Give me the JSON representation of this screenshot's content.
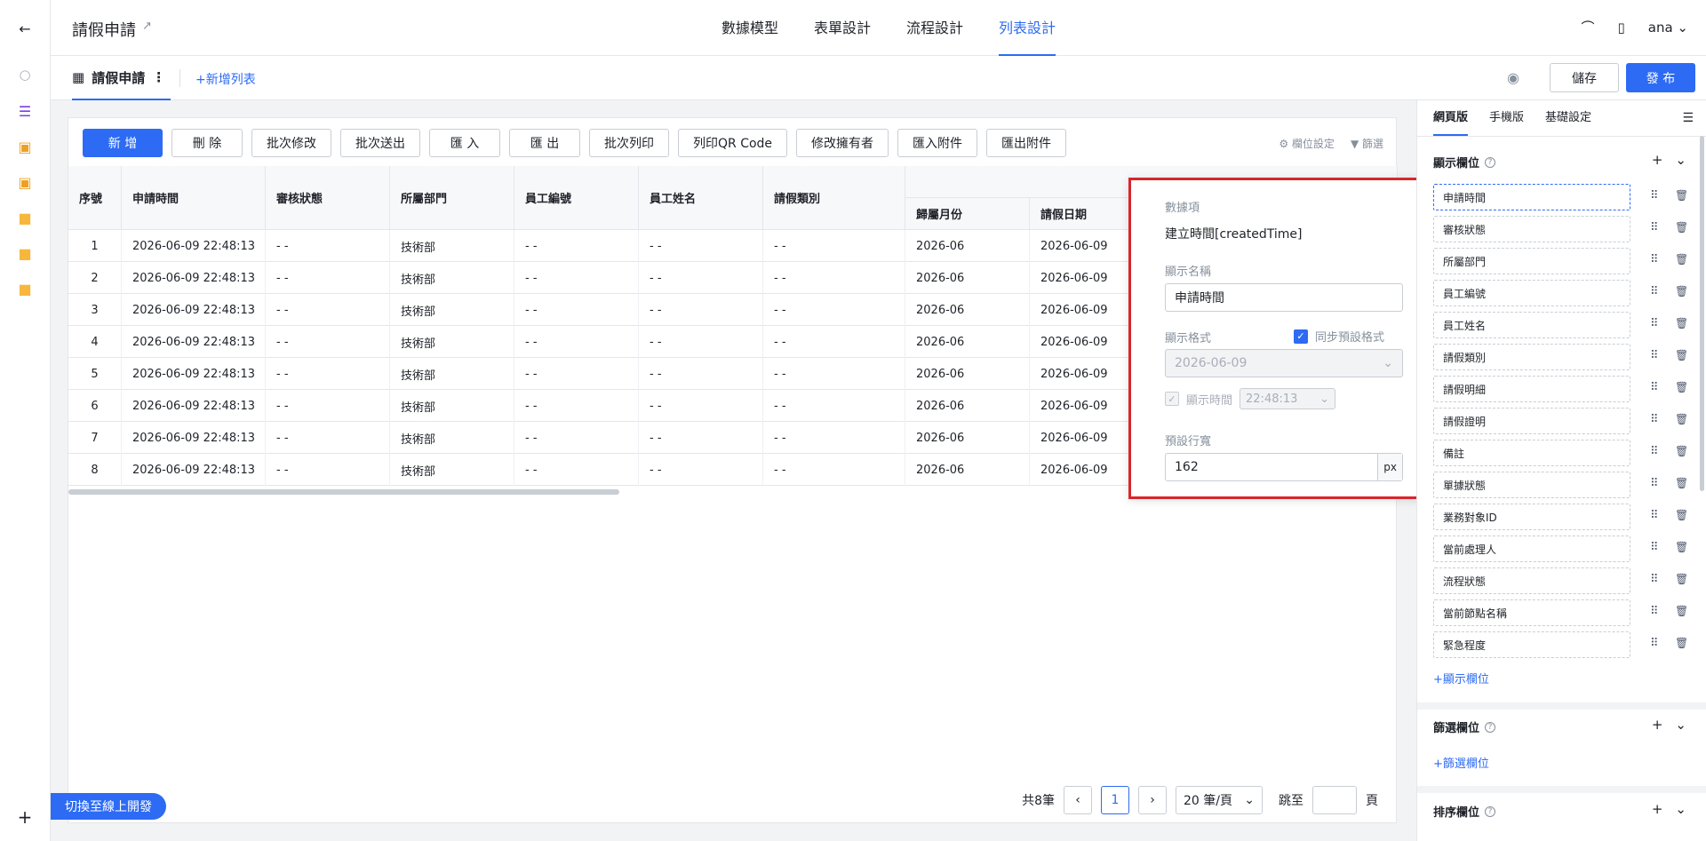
{
  "app": {
    "title": "請假申請",
    "user": "ana",
    "tabs": [
      {
        "label": "數據模型"
      },
      {
        "label": "表單設計"
      },
      {
        "label": "流程設計"
      },
      {
        "label": "列表設計",
        "active": true
      }
    ]
  },
  "subbar": {
    "list_name": "請假申請",
    "add_list": "新增列表",
    "save": "儲存",
    "publish": "發 布"
  },
  "toolbar": {
    "buttons": [
      "新 增",
      "刪 除",
      "批次修改",
      "批次送出",
      "匯 入",
      "匯 出",
      "批次列印",
      "列印QR Code",
      "修改擁有者",
      "匯入附件",
      "匯出附件"
    ],
    "field_settings": "欄位設定",
    "filter": "篩選"
  },
  "table": {
    "headers": [
      "序號",
      "申請時間",
      "審核狀態",
      "所屬部門",
      "員工編號",
      "員工姓名",
      "請假類別"
    ],
    "sub_headers": [
      "歸屬月份",
      "請假日期"
    ],
    "rows": [
      {
        "no": "1",
        "time": "2026-06-09 22:48:13",
        "status": "- -",
        "dept": "技術部",
        "emp_no": "- -",
        "emp_name": "- -",
        "type": "- -",
        "month": "2026-06",
        "date": "2026-06-09"
      },
      {
        "no": "2",
        "time": "2026-06-09 22:48:13",
        "status": "- -",
        "dept": "技術部",
        "emp_no": "- -",
        "emp_name": "- -",
        "type": "- -",
        "month": "2026-06",
        "date": "2026-06-09"
      },
      {
        "no": "3",
        "time": "2026-06-09 22:48:13",
        "status": "- -",
        "dept": "技術部",
        "emp_no": "- -",
        "emp_name": "- -",
        "type": "- -",
        "month": "2026-06",
        "date": "2026-06-09"
      },
      {
        "no": "4",
        "time": "2026-06-09 22:48:13",
        "status": "- -",
        "dept": "技術部",
        "emp_no": "- -",
        "emp_name": "- -",
        "type": "- -",
        "month": "2026-06",
        "date": "2026-06-09"
      },
      {
        "no": "5",
        "time": "2026-06-09 22:48:13",
        "status": "- -",
        "dept": "技術部",
        "emp_no": "- -",
        "emp_name": "- -",
        "type": "- -",
        "month": "2026-06",
        "date": "2026-06-09"
      },
      {
        "no": "6",
        "time": "2026-06-09 22:48:13",
        "status": "- -",
        "dept": "技術部",
        "emp_no": "- -",
        "emp_name": "- -",
        "type": "- -",
        "month": "2026-06",
        "date": "2026-06-09"
      },
      {
        "no": "7",
        "time": "2026-06-09 22:48:13",
        "status": "- -",
        "dept": "技術部",
        "emp_no": "- -",
        "emp_name": "- -",
        "type": "- -",
        "month": "2026-06",
        "date": "2026-06-09"
      },
      {
        "no": "8",
        "time": "2026-06-09 22:48:13",
        "status": "- -",
        "dept": "技術部",
        "emp_no": "- -",
        "emp_name": "- -",
        "type": "- -",
        "month": "2026-06",
        "date": "2026-06-09"
      }
    ]
  },
  "popup": {
    "data_item_label": "數據項",
    "data_item_value": "建立時間[createdTime]",
    "display_name_label": "顯示名稱",
    "display_name_value": "申請時間",
    "format_label": "顯示格式",
    "sync_label": "同步預設格式",
    "format_value": "2026-06-09",
    "show_time_label": "顯示時間",
    "time_value": "22:48:13",
    "width_label": "預設行寬",
    "width_value": "162",
    "width_unit": "px"
  },
  "pager": {
    "total": "共8筆",
    "current": "1",
    "size": "20 筆/頁",
    "jump": "跳至",
    "page": "頁"
  },
  "switch_label": "切換至線上開發",
  "rpanel": {
    "tabs": [
      "網頁版",
      "手機版",
      "基礎設定"
    ],
    "display_section": "顯示欄位",
    "display_fields": [
      "申請時間",
      "審核狀態",
      "所屬部門",
      "員工編號",
      "員工姓名",
      "請假類別",
      "請假明細",
      "請假證明",
      "備註",
      "單據狀態",
      "業務對象ID",
      "當前處理人",
      "流程狀態",
      "當前節點名稱",
      "緊急程度"
    ],
    "add_display": "顯示欄位",
    "filter_section": "篩選欄位",
    "add_filter": "篩選欄位",
    "sort_section": "排序欄位"
  },
  "colors": {
    "accent": "#2d6bf5",
    "highlight": "#d9262c"
  }
}
